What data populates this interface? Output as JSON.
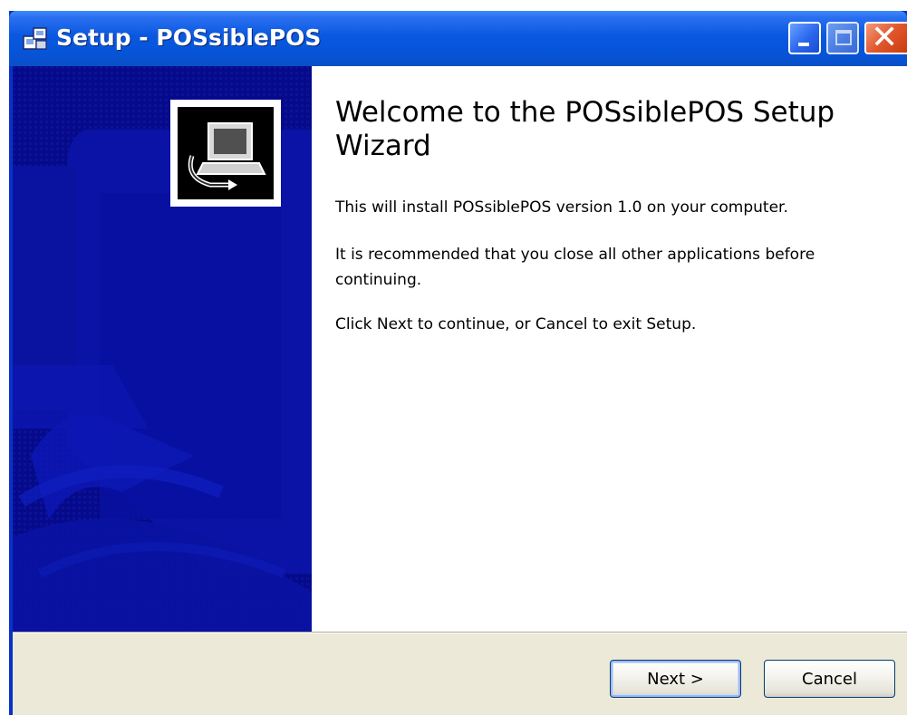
{
  "window": {
    "title": "Setup - POSsiblePOS",
    "icon": "setup-installer-icon",
    "controls": {
      "minimize_icon": "minimize-icon",
      "maximize_icon": "maximize-icon",
      "close_icon": "close-icon",
      "close_glyph": "✕"
    },
    "colors": {
      "titlebar": "#0654d8",
      "side_panel": "#060a8a",
      "close_button": "#e2562c",
      "dialog_background": "#ece9d8"
    }
  },
  "wizard": {
    "heading": "Welcome to the POSsiblePOS Setup Wizard",
    "paragraphs": [
      "This will install POSsiblePOS version 1.0 on your computer.",
      "It is recommended that you close all other applications before continuing.",
      "Click Next to continue, or Cancel to exit Setup."
    ],
    "side_image_icon": "computer-install-icon"
  },
  "buttons": {
    "next": "Next >",
    "cancel": "Cancel"
  }
}
